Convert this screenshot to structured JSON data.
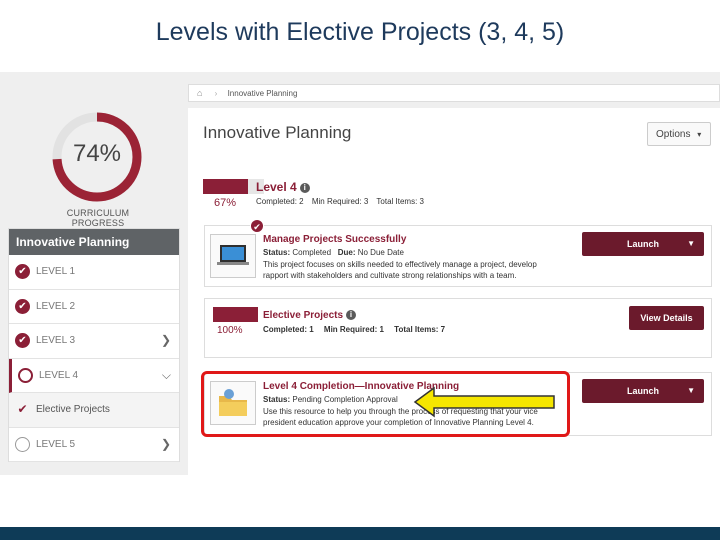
{
  "slide": {
    "title": "Levels with Elective Projects (3, 4, 5)"
  },
  "progress": {
    "percent_text": "74%",
    "value": 0.74,
    "label": "CURRICULUM PROGRESS",
    "color": "#9b2335"
  },
  "sidebar": {
    "header": "Innovative Planning",
    "items": [
      {
        "label": "LEVEL 1",
        "state": "complete"
      },
      {
        "label": "LEVEL 2",
        "state": "complete"
      },
      {
        "label": "LEVEL 3",
        "state": "complete"
      },
      {
        "label": "LEVEL 4",
        "state": "open"
      },
      {
        "label": "Elective Projects",
        "state": "sub-complete"
      },
      {
        "label": "LEVEL 5",
        "state": "incomplete"
      }
    ]
  },
  "breadcrumb": {
    "home_icon": "home-icon",
    "current": "Innovative Planning"
  },
  "main": {
    "title": "Innovative Planning",
    "options_label": "Options",
    "level": {
      "title": "Level 4",
      "percent_text": "67%",
      "percent": 67,
      "completed": "Completed: 2",
      "min_required": "Min Required: 3",
      "total_items": "Total Items: 3"
    },
    "project1": {
      "title": "Manage Projects Successfully",
      "status_label": "Status:",
      "status_value": "Completed",
      "due_label": "Due:",
      "due_value": "No Due Date",
      "description": "This project focuses on skills needed to effectively manage a project, develop rapport with stakeholders and cultivate strong relationships with a team.",
      "button": "Launch"
    },
    "electives": {
      "title": "Elective Projects",
      "percent_text": "100%",
      "percent": 100,
      "completed": "Completed: 1",
      "min_required": "Min Required: 1",
      "total_items": "Total Items: 7",
      "button": "View Details"
    },
    "project2": {
      "title": "Level 4 Completion—Innovative Planning",
      "status_label": "Status:",
      "status_value": "Pending Completion Approval",
      "description": "Use this resource to help you through the process of requesting that your vice president education approve your completion of Innovative Planning Level 4.",
      "button": "Launch"
    }
  },
  "colors": {
    "brand": "#8b1f37",
    "button": "#6b1a2c",
    "highlight": "#e01818",
    "arrow": "#f5e600",
    "footer": "#0e3b57"
  }
}
